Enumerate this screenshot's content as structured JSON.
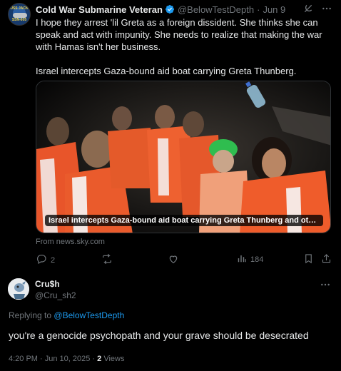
{
  "tweet": {
    "author_name": "Cold War Submarine Veteran",
    "author_handle": "@BelowTestDepth",
    "date": "Jun 9",
    "separator": "·",
    "avatar_text_top": "USS JACK",
    "avatar_text_bottom": "SSN-605",
    "text_p1": "I hope they arrest 'lil Greta as a foreign dissident.  She thinks she can speak and act with impunity.  She needs to realize that making the war with Hamas isn't her business.",
    "text_p2": "Israel intercepts Gaza-bound aid boat carrying Greta Thunberg.",
    "media_caption": "Israel intercepts Gaza-bound aid boat carrying Greta Thunberg and other activ...",
    "source": "From news.sky.com",
    "actions": {
      "replies": "2",
      "retweets": "",
      "likes": "",
      "views": "184"
    },
    "icons": {
      "verified": "verified-badge-icon",
      "grok": "grok-icon",
      "more": "more-icon",
      "reply": "reply-icon",
      "retweet": "retweet-icon",
      "like": "like-icon",
      "views": "views-icon",
      "bookmark": "bookmark-icon",
      "share": "share-icon"
    }
  },
  "reply": {
    "author_name": "Cru$h",
    "author_handle": "@Cru_sh2",
    "replying_prefix": "Replying to",
    "replying_to": "@BelowTestDepth",
    "text": "you're a genocide psychopath and your grave should be desecrated",
    "time": "4:20 PM · Jun 10, 2025 ·",
    "views_count": "2",
    "views_label": "Views"
  },
  "colors": {
    "background": "#000000",
    "text": "#e7e9ea",
    "muted": "#71767b",
    "link": "#1d9bf0",
    "verified": "#1d9bf0"
  }
}
